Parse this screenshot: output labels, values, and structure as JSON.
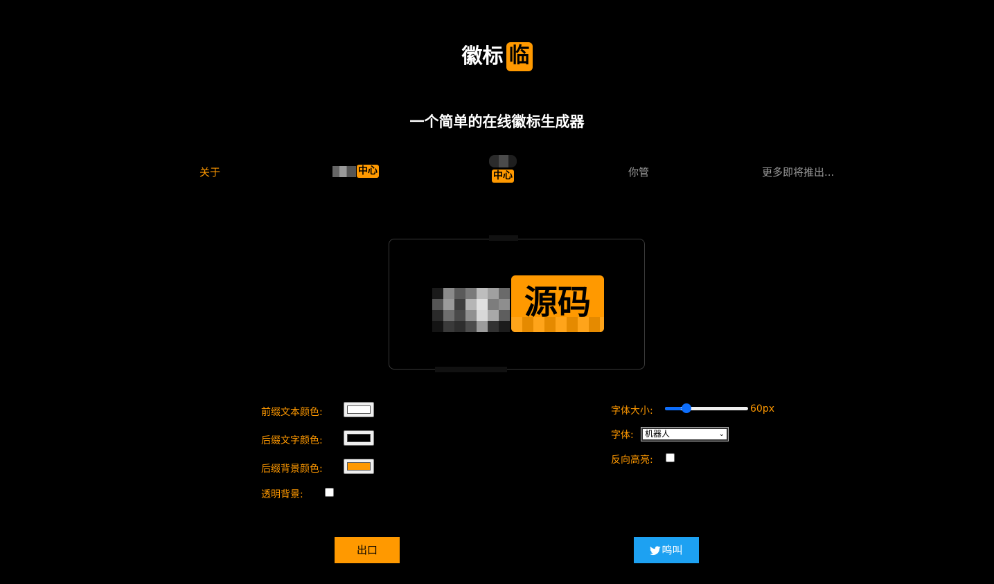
{
  "brand": {
    "prefix": "徽标",
    "suffix": "临"
  },
  "tagline": "一个简单的在线徽标生成器",
  "nav": {
    "about": "关于",
    "hub1_badge": "中心",
    "hub2_badge": "中心",
    "whatever": "你管",
    "more": "更多即将推出..."
  },
  "preview": {
    "suffix_text": "源码"
  },
  "controls": {
    "prefix_color_label": "前缀文本颜色:",
    "prefix_color": "#ffffff",
    "suffix_text_color_label": "后缀文字颜色:",
    "suffix_text_color": "#000000",
    "suffix_bg_color_label": "后缀背景颜色:",
    "suffix_bg_color": "#ff9900",
    "transparent_bg_label": "透明背景:",
    "transparent_bg": false,
    "font_size_label": "字体大小:",
    "font_size_value": "60px",
    "font_size_fraction": 0.2,
    "font_label": "字体:",
    "font_selected": "机器人",
    "reverse_highlight_label": "反向高亮:",
    "reverse_highlight": false
  },
  "buttons": {
    "export": "出口",
    "tweet": "鸣叫"
  },
  "icons": {
    "tweet": "twitter-bird-icon",
    "select_caret": "chevron-down-icon"
  },
  "colors": {
    "accent": "#ff9900",
    "background": "#000000",
    "twitter": "#1da1f2",
    "slider": "#0d6efd",
    "muted": "#9a9a9a"
  }
}
